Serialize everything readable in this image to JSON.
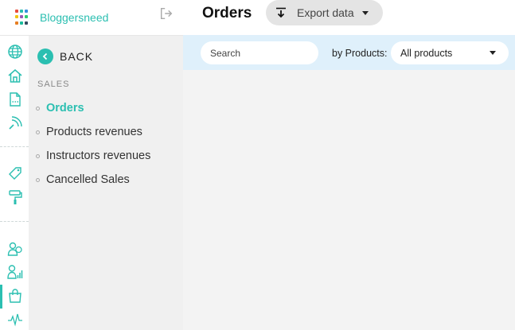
{
  "brand": {
    "name": "Bloggersneed",
    "logo_colors": [
      "#e84c3d",
      "#2bbfb1",
      "#3b8ede",
      "#f1c40f",
      "#9b59b6",
      "#2ecc71",
      "#e67e22",
      "#1abc9c",
      "#34495e"
    ]
  },
  "rail": {
    "icons": [
      "globe-icon",
      "home-icon",
      "document-icon",
      "broadcast-icon",
      "tag-icon",
      "paint-roller-icon",
      "users-icon",
      "user-stats-icon",
      "shopping-bag-icon",
      "activity-icon"
    ],
    "active": "shopping-bag-icon"
  },
  "subnav": {
    "back_label": "BACK",
    "section_label": "SALES",
    "items": [
      {
        "label": "Orders",
        "active": true
      },
      {
        "label": "Products revenues",
        "active": false
      },
      {
        "label": "Instructors revenues",
        "active": false
      },
      {
        "label": "Cancelled Sales",
        "active": false
      }
    ]
  },
  "header": {
    "title": "Orders",
    "export_label": "Export data"
  },
  "filters": {
    "search_placeholder": "Search",
    "by_products_label": "by Products:",
    "products_selected": "All products"
  },
  "colors": {
    "accent": "#2bbfb1",
    "filter_bar": "#dff0fb"
  }
}
